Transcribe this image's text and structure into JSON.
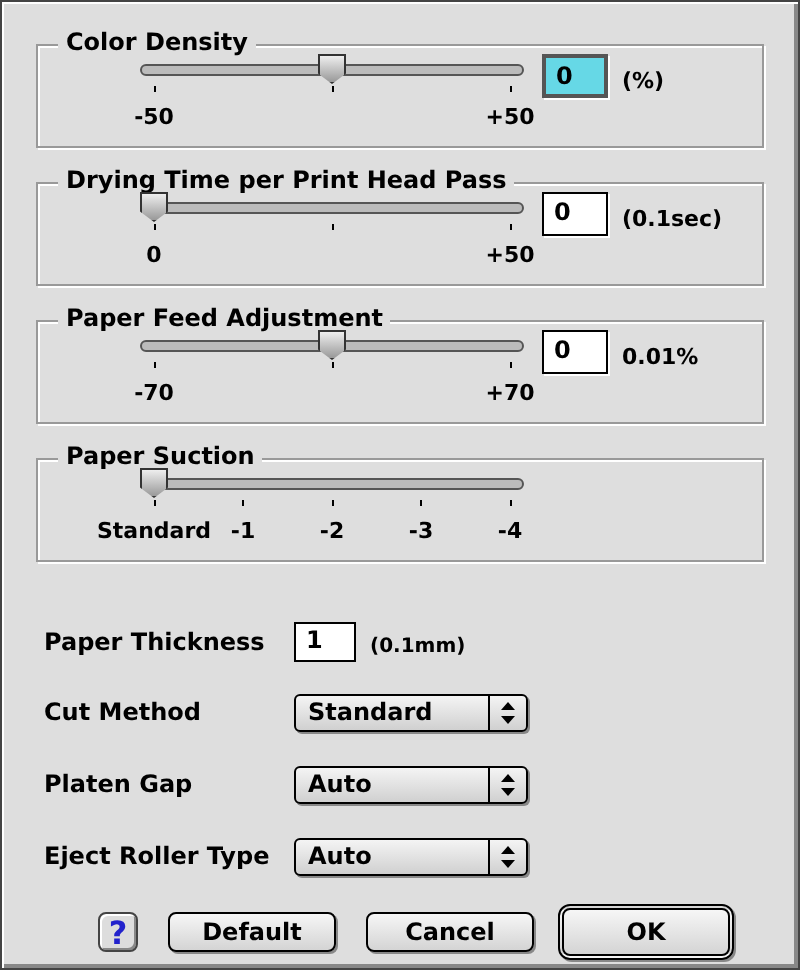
{
  "groups": [
    {
      "title": "Color Density",
      "slider": {
        "level": 0.5
      },
      "tick_labels": [
        "-50",
        "+50"
      ],
      "middle_tick": true,
      "field": {
        "value": "0",
        "highlighted": true
      },
      "unit": "(%)"
    },
    {
      "title": "Drying Time per Print Head Pass",
      "slider": {
        "level": 0
      },
      "tick_labels": [
        "0",
        "+50"
      ],
      "middle_tick": true,
      "field": {
        "value": "0",
        "highlighted": false
      },
      "unit": "(0.1sec)"
    },
    {
      "title": "Paper Feed Adjustment",
      "slider": {
        "level": 0.5
      },
      "tick_labels": [
        "-70",
        "+70"
      ],
      "middle_tick": true,
      "field": {
        "value": "0",
        "highlighted": false
      },
      "unit": "0.01%"
    },
    {
      "title": "Paper Suction",
      "slider": {
        "level": 0
      },
      "tick_labels": [
        "Standard",
        "-1",
        "-2",
        "-3",
        "-4"
      ],
      "middle_tick": false
    }
  ],
  "paper_thickness": {
    "label": "Paper Thickness",
    "value": "1",
    "unit": "(0.1mm)"
  },
  "popups": [
    {
      "label": "Cut Method",
      "value": "Standard"
    },
    {
      "label": "Platen Gap",
      "value": "Auto"
    },
    {
      "label": "Eject Roller Type",
      "value": "Auto"
    }
  ],
  "help_button": "?",
  "buttons": [
    {
      "label": "Default",
      "default": false
    },
    {
      "label": "Cancel",
      "default": false
    },
    {
      "label": "OK",
      "default": true
    }
  ]
}
